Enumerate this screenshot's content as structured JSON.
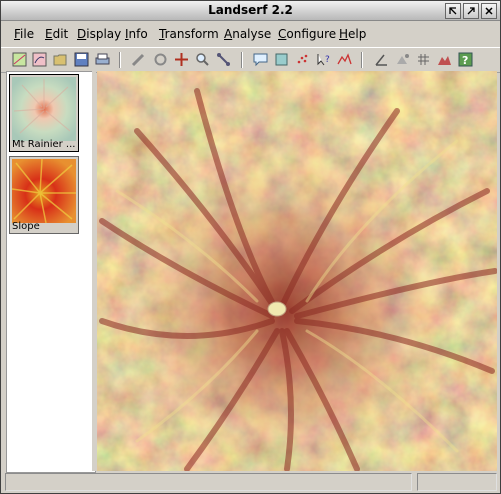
{
  "window": {
    "title": "Landserf 2.2"
  },
  "menu": [
    {
      "label": "File",
      "key": "F"
    },
    {
      "label": "Edit",
      "key": "E"
    },
    {
      "label": "Display",
      "key": "D"
    },
    {
      "label": "Info",
      "key": "I"
    },
    {
      "label": "Transform",
      "key": "T"
    },
    {
      "label": "Analyse",
      "key": "A"
    },
    {
      "label": "Configure",
      "key": "C"
    },
    {
      "label": "Help",
      "key": "H"
    }
  ],
  "toolbar": {
    "icons": [
      "new-raster-icon",
      "new-vector-icon",
      "open-icon",
      "save-icon",
      "print-icon",
      "edit-pencil-icon",
      "rotate-icon",
      "crosshair-icon",
      "zoom-icon",
      "pan-icon",
      "info-balloon-icon",
      "layers-icon",
      "scatter-plot-icon",
      "query-icon",
      "profile-icon",
      "angle-icon",
      "contours-icon",
      "grid-icon",
      "terrain-icon",
      "help-icon"
    ]
  },
  "layers": [
    {
      "label": "Mt Rainier ...",
      "selected": true
    },
    {
      "label": "Slope",
      "selected": false
    }
  ],
  "status": {
    "left": "",
    "right": ""
  }
}
